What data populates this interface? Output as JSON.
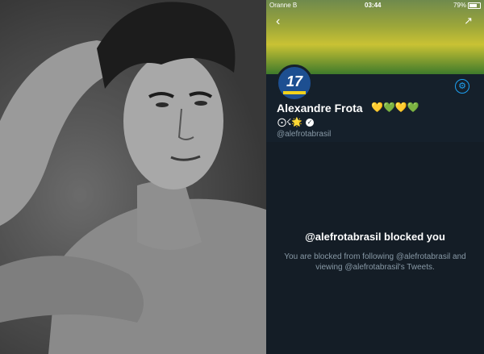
{
  "status_bar": {
    "carrier": "Oranne B",
    "time": "03:44",
    "battery": "79%"
  },
  "profile": {
    "name": "Alexandre Frota",
    "name_emojis": "💛💚💛💚",
    "bio_symbols": "⨀☇🌟",
    "handle": "@alefrotabrasil",
    "avatar_text": "17"
  },
  "blocked": {
    "title": "@alefrotabrasil blocked you",
    "description": "You are blocked from following @alefrotabrasil and viewing @alefrotabrasil's Tweets."
  },
  "colors": {
    "accent": "#1da1f2",
    "background": "#15202b",
    "muted": "#8899a6"
  },
  "icons": [
    "back-arrow-icon",
    "share-icon",
    "settings-icon",
    "verified-icon"
  ]
}
